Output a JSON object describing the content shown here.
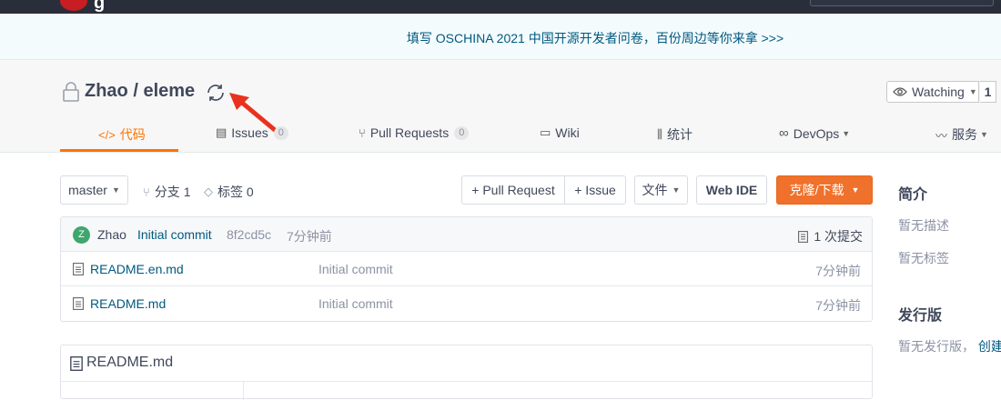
{
  "banner": {
    "text": "填写 OSCHINA 2021 中国开源开发者问卷，百份周边等你来拿 >>>"
  },
  "repo": {
    "title": "Zhao / eleme"
  },
  "watch": {
    "label": "Watching",
    "count": "1"
  },
  "tabs": [
    {
      "label": "代码",
      "icon": "code-icon",
      "active": true
    },
    {
      "label": "Issues",
      "icon": "issues-icon",
      "badge": "0"
    },
    {
      "label": "Pull Requests",
      "icon": "pull-request-icon",
      "badge": "0"
    },
    {
      "label": "Wiki",
      "icon": "wiki-icon"
    },
    {
      "label": "统计",
      "icon": "stats-icon"
    },
    {
      "label": "DevOps",
      "icon": "devops-icon"
    },
    {
      "label": "服务",
      "icon": "service-icon"
    }
  ],
  "toolbar": {
    "branch": "master",
    "branches": "分支 1",
    "tags": "标签 0",
    "pull_request": "+ Pull Request",
    "issue": "+ Issue",
    "file": "文件",
    "web_ide": "Web IDE",
    "clone": "克隆/下载"
  },
  "commit": {
    "avatar": "Z",
    "author": "Zhao",
    "message": "Initial commit",
    "sha": "8f2cd5c",
    "time": "7分钟前",
    "count": "1 次提交"
  },
  "files": [
    {
      "name": "README.en.md",
      "message": "Initial commit",
      "time": "7分钟前"
    },
    {
      "name": "README.md",
      "message": "Initial commit",
      "time": "7分钟前"
    }
  ],
  "readme": {
    "title": "README.md"
  },
  "sidebar": {
    "intro_heading": "简介",
    "no_description": "暂无描述",
    "no_tags": "暂无标签",
    "release_heading": "发行版",
    "no_release": "暂无发行版，",
    "create_link": "创建"
  },
  "colors": {
    "accent": "#fe7300",
    "clone_button": "#f0712b",
    "link": "#005980",
    "topbar": "#292e3a"
  }
}
